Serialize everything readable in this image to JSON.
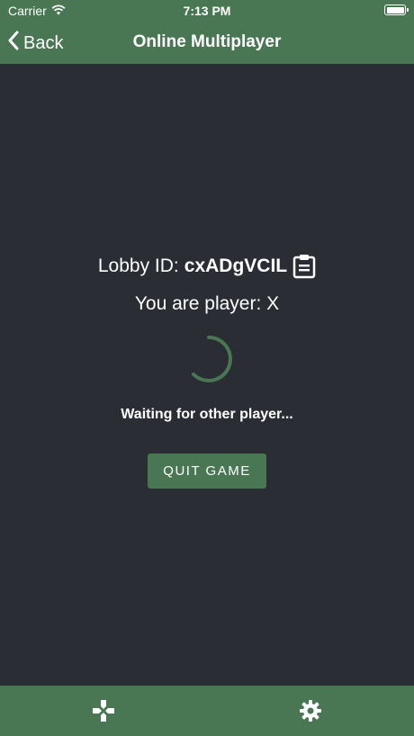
{
  "status_bar": {
    "carrier": "Carrier",
    "time": "7:13 PM",
    "battery_level": 1.0,
    "wifi_icon": "wifi-icon"
  },
  "nav": {
    "back_label": "Back",
    "title": "Online Multiplayer"
  },
  "lobby": {
    "id_label": "Lobby ID:",
    "id_value": "cxADgVCIL",
    "player_text": "You are player: X",
    "waiting_text": "Waiting for other player...",
    "quit_label": "QUIT GAME"
  },
  "tab_bar": {
    "items": [
      "gamepad-icon",
      "gear-icon"
    ]
  },
  "colors": {
    "accent": "#4a7753",
    "background": "#2a2d33",
    "text": "#ffffff"
  }
}
